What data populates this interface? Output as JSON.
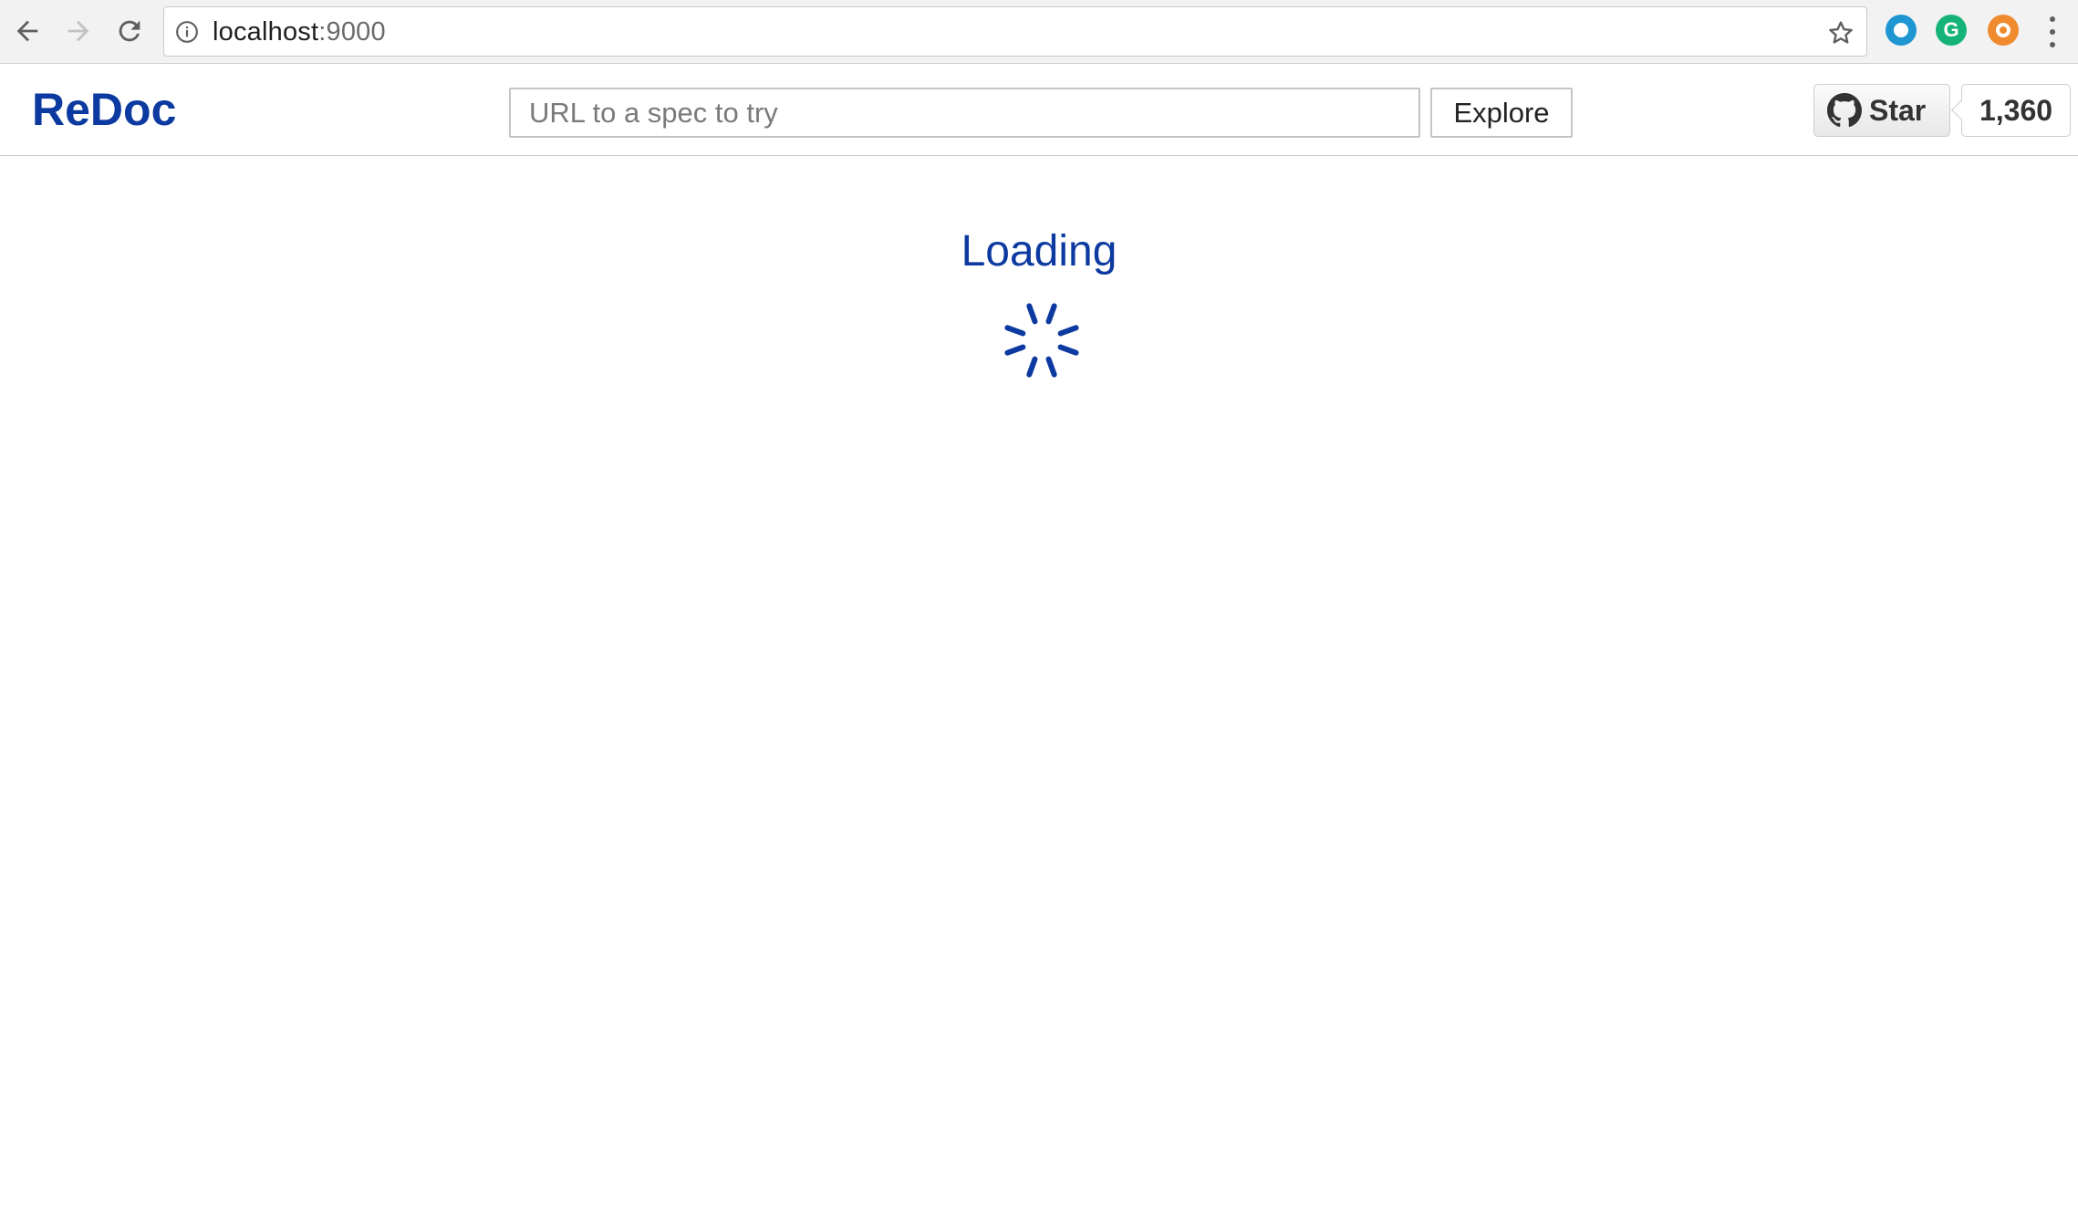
{
  "browser": {
    "url_host": "localhost",
    "url_port": ":9000",
    "extensions": [
      "circle-extension-icon",
      "grammarly-icon",
      "orange-extension-icon"
    ],
    "grammarly_letter": "G"
  },
  "header": {
    "logo": "ReDoc",
    "spec_placeholder": "URL to a spec to try",
    "explore_label": "Explore",
    "github_star_label": "Star",
    "github_star_count": "1,360"
  },
  "main": {
    "loading_text": "Loading"
  },
  "colors": {
    "brand": "#0c3aa0",
    "chrome_bg": "#f2f2f2"
  }
}
